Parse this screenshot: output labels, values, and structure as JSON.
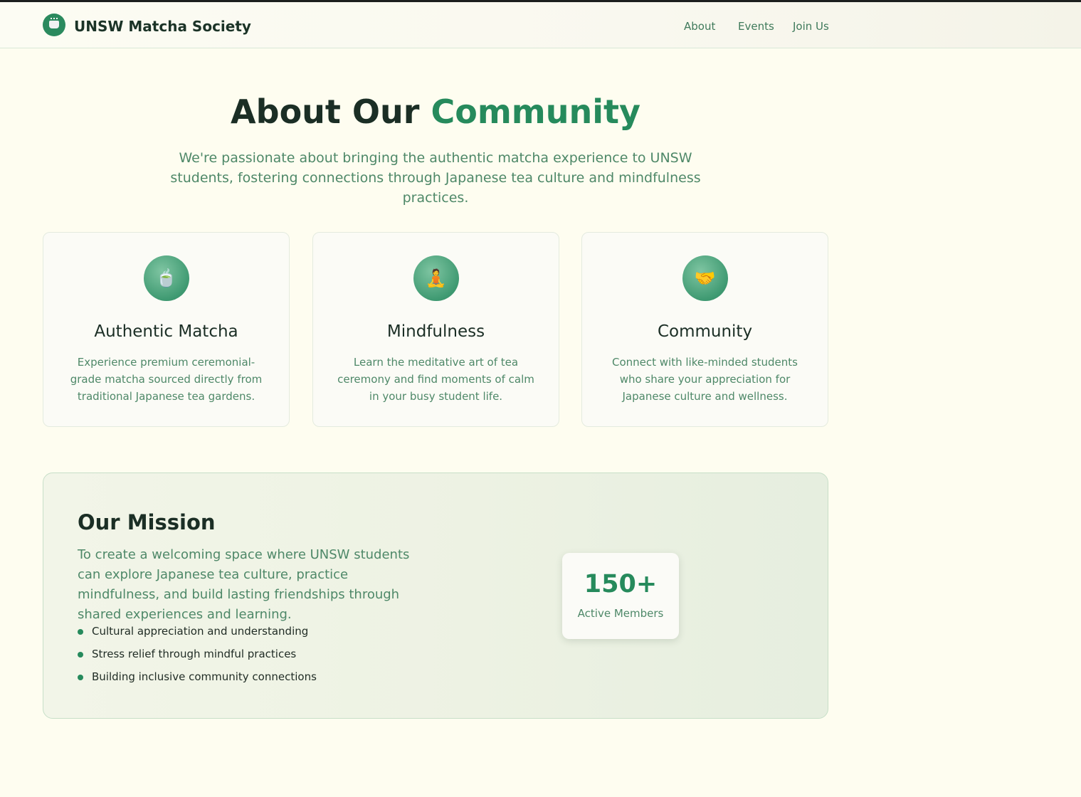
{
  "header": {
    "brand": "UNSW Matcha Society",
    "logo_icon": "tea-cup-icon",
    "nav": [
      {
        "label": "About"
      },
      {
        "label": "Events"
      },
      {
        "label": "Join Us"
      }
    ]
  },
  "hero": {
    "title_main": "About Our ",
    "title_accent": "Community",
    "subtitle": "We're passionate about bringing the authentic matcha experience to UNSW students, fostering connections through Japanese tea culture and mindfulness practices."
  },
  "features": [
    {
      "icon": "tea-cup-icon",
      "glyph": "🍵",
      "title": "Authentic Matcha",
      "text": "Experience premium ceremonial-grade matcha sourced directly from traditional Japanese tea gardens."
    },
    {
      "icon": "meditation-icon",
      "glyph": "🧘",
      "title": "Mindfulness",
      "text": "Learn the meditative art of tea ceremony and find moments of calm in your busy student life."
    },
    {
      "icon": "handshake-icon",
      "glyph": "🤝",
      "title": "Community",
      "text": "Connect with like-minded students who share your appreciation for Japanese culture and wellness."
    }
  ],
  "mission": {
    "title": "Our Mission",
    "text": "To create a welcoming space where UNSW students can explore Japanese tea culture, practice mindfulness, and build lasting friendships through shared experiences and learning.",
    "points": [
      "Cultural appreciation and understanding",
      "Stress relief through mindful practices",
      "Building inclusive community connections"
    ],
    "stat": {
      "value": "150+",
      "label": "Active Members"
    }
  },
  "colors": {
    "accent": "#268a5c",
    "background": "#fefdf0",
    "heading": "#1b2e25",
    "muted_text": "#4e8868"
  }
}
